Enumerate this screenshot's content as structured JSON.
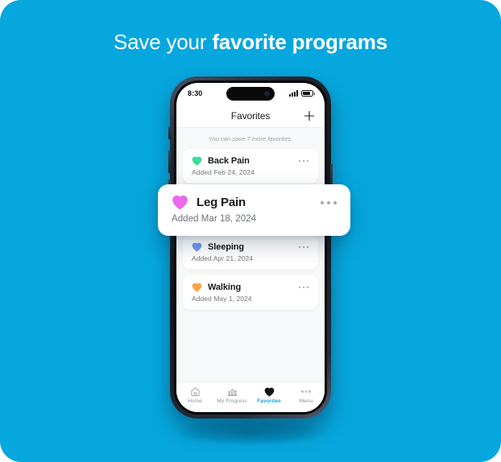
{
  "page": {
    "background_color": "#06A7DE",
    "headline_prefix": "Save your ",
    "headline_bold": "favorite programs"
  },
  "phone": {
    "status_bar": {
      "time": "8:30",
      "signal_icon": "signal-bars-icon",
      "battery_icon": "battery-icon"
    },
    "nav": {
      "title": "Favorites",
      "add_icon": "plus-icon"
    },
    "quota_note": "You can save 7 more favorites.",
    "favorites": [
      {
        "name": "Back Pain",
        "date": "Added Feb 24, 2024",
        "heart_color": "#3ddc97",
        "menu_icon": "overflow-menu-icon"
      },
      {
        "name": "Sleeping",
        "date": "Added Apr 21, 2024",
        "heart_color": "#6f9af5",
        "menu_icon": "overflow-menu-icon"
      },
      {
        "name": "Walking",
        "date": "Added May 1, 2024",
        "heart_color": "#fba346",
        "menu_icon": "overflow-menu-icon"
      }
    ],
    "highlighted_favorite": {
      "name": "Leg Pain",
      "date": "Added Mar 18, 2024",
      "heart_color": "#ec68ec",
      "menu_icon": "overflow-menu-icon"
    },
    "tabs": [
      {
        "label": "Home",
        "icon": "home-icon",
        "active": false
      },
      {
        "label": "My Progress",
        "icon": "bar-chart-icon",
        "active": false
      },
      {
        "label": "Favorites",
        "icon": "heart-filled-icon",
        "active": true
      },
      {
        "label": "Menu",
        "icon": "overflow-menu-icon",
        "active": false
      }
    ],
    "active_tab_color": "#06A7DE"
  }
}
